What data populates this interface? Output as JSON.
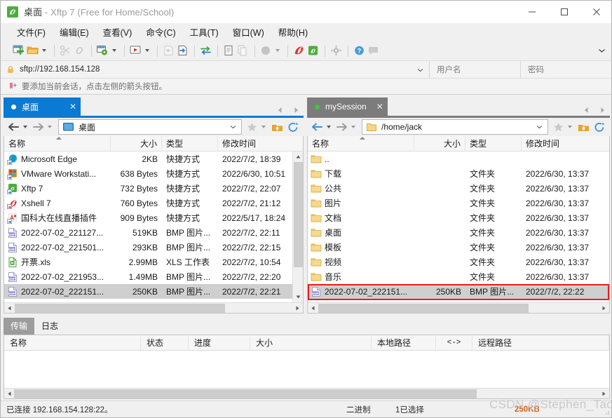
{
  "window": {
    "title_main": "桌面",
    "title_rest": " - Xftp 7 (Free for Home/School)",
    "app_icon": "xftp-logo-icon",
    "minimize": "—",
    "maximize": "▢",
    "close": "✕"
  },
  "menu": [
    {
      "label": "文件(F)",
      "name": "menu-file"
    },
    {
      "label": "编辑(E)",
      "name": "menu-edit"
    },
    {
      "label": "查看(V)",
      "name": "menu-view"
    },
    {
      "label": "命令(C)",
      "name": "menu-command"
    },
    {
      "label": "工具(T)",
      "name": "menu-tools"
    },
    {
      "label": "窗口(W)",
      "name": "menu-window"
    },
    {
      "label": "帮助(H)",
      "name": "menu-help"
    }
  ],
  "toolbar": {
    "items": [
      "new-session-icon",
      "open-folder-icon",
      "open-folder-dropdown",
      "cut-link-icon",
      "link-icon",
      "session-settings-icon",
      "session-settings-dropdown",
      "transfer-start-icon",
      "transfer-start-dropdown",
      "transfer-left-icon",
      "transfer-right-icon",
      "sync-transfer-icon",
      "paste-icon",
      "copy-icon",
      "status-circle-icon",
      "status-dropdown",
      "xshell-icon",
      "xftp-icon",
      "settings-gear-icon",
      "help-icon",
      "feedback-icon"
    ],
    "overflow": "overflow-chevron-icon"
  },
  "address": {
    "lock_icon": "lock-icon",
    "url": "sftp://192.168.154.128",
    "dropdown_icon": "chevron-down-icon",
    "username_placeholder": "用户名",
    "password_placeholder": "密码",
    "hint_icon": "bookmark-arrow-icon",
    "hint": "要添加当前会话，点击左侧的箭头按钮。"
  },
  "left_pane": {
    "tab": {
      "label": "桌面",
      "dot": "white-dot-icon",
      "close": "✕"
    },
    "nav": {
      "back": "back-arrow-icon",
      "back_dd": "chevron-down-icon",
      "forward": "forward-arrow-icon",
      "forward_dd": "chevron-down-icon",
      "path_icon": "desktop-icon",
      "path": "桌面",
      "path_chevron": "chevron-down-icon",
      "favorite": "star-icon",
      "favorite_dd": "chevron-down-icon",
      "home": "home-folder-icon",
      "refresh": "refresh-icon"
    },
    "columns": [
      "名称",
      "大小",
      "类型",
      "修改时间"
    ],
    "rows": [
      {
        "icon": "edge-shortcut-icon",
        "name": "Microsoft Edge",
        "size": "2KB",
        "type": "快捷方式",
        "time": "2022/7/2, 18:39",
        "selected": false
      },
      {
        "icon": "vmware-shortcut-icon",
        "name": "VMware Workstati...",
        "size": "638 Bytes",
        "type": "快捷方式",
        "time": "2022/6/30, 10:51",
        "selected": false
      },
      {
        "icon": "xftp-shortcut-icon",
        "name": "Xftp 7",
        "size": "732 Bytes",
        "type": "快捷方式",
        "time": "2022/7/2, 22:07",
        "selected": false
      },
      {
        "icon": "xshell-shortcut-icon",
        "name": "Xshell 7",
        "size": "760 Bytes",
        "type": "快捷方式",
        "time": "2022/7/2, 21:12",
        "selected": false
      },
      {
        "icon": "plugin-shortcut-icon",
        "name": "国科大在线直播插件",
        "size": "909 Bytes",
        "type": "快捷方式",
        "time": "2022/5/17, 18:24",
        "selected": false
      },
      {
        "icon": "bmp-file-icon",
        "name": "2022-07-02_221127...",
        "size": "519KB",
        "type": "BMP 图片...",
        "time": "2022/7/2, 22:11",
        "selected": false
      },
      {
        "icon": "bmp-file-icon",
        "name": "2022-07-02_221501...",
        "size": "293KB",
        "type": "BMP 图片...",
        "time": "2022/7/2, 22:15",
        "selected": false
      },
      {
        "icon": "xls-file-icon",
        "name": "开票.xls",
        "size": "2.99MB",
        "type": "XLS 工作表",
        "time": "2022/7/2, 10:54",
        "selected": false
      },
      {
        "icon": "bmp-file-icon",
        "name": "2022-07-02_221953...",
        "size": "1.49MB",
        "type": "BMP 图片...",
        "time": "2022/7/2, 22:20",
        "selected": false
      },
      {
        "icon": "bmp-file-icon",
        "name": "2022-07-02_222151...",
        "size": "250KB",
        "type": "BMP 图片...",
        "time": "2022/7/2, 22:21",
        "selected": true
      }
    ]
  },
  "right_pane": {
    "tab": {
      "label": "mySession",
      "dot": "green-dot-icon",
      "close": "✕"
    },
    "nav": {
      "back": "back-arrow-icon",
      "back_dd": "chevron-down-icon",
      "forward": "forward-arrow-icon",
      "forward_dd": "chevron-down-icon",
      "path_icon": "folder-icon",
      "path": "/home/jack",
      "path_chevron": "chevron-down-icon",
      "favorite": "star-icon",
      "favorite_dd": "chevron-down-icon",
      "home": "home-folder-icon",
      "refresh": "refresh-icon"
    },
    "columns": [
      "名称",
      "大小",
      "类型",
      "修改时间"
    ],
    "rows": [
      {
        "icon": "folder-icon",
        "name": "..",
        "size": "",
        "type": "",
        "time": "",
        "highlight": false
      },
      {
        "icon": "folder-icon",
        "name": "下载",
        "size": "",
        "type": "文件夹",
        "time": "2022/6/30, 13:37",
        "highlight": false
      },
      {
        "icon": "folder-icon",
        "name": "公共",
        "size": "",
        "type": "文件夹",
        "time": "2022/6/30, 13:37",
        "highlight": false
      },
      {
        "icon": "folder-icon",
        "name": "图片",
        "size": "",
        "type": "文件夹",
        "time": "2022/6/30, 13:37",
        "highlight": false
      },
      {
        "icon": "folder-icon",
        "name": "文档",
        "size": "",
        "type": "文件夹",
        "time": "2022/6/30, 13:37",
        "highlight": false
      },
      {
        "icon": "folder-icon",
        "name": "桌面",
        "size": "",
        "type": "文件夹",
        "time": "2022/6/30, 13:37",
        "highlight": false
      },
      {
        "icon": "folder-icon",
        "name": "模板",
        "size": "",
        "type": "文件夹",
        "time": "2022/6/30, 13:37",
        "highlight": false
      },
      {
        "icon": "folder-icon",
        "name": "视频",
        "size": "",
        "type": "文件夹",
        "time": "2022/6/30, 13:37",
        "highlight": false
      },
      {
        "icon": "folder-icon",
        "name": "音乐",
        "size": "",
        "type": "文件夹",
        "time": "2022/6/30, 13:37",
        "highlight": false
      },
      {
        "icon": "bmp-file-icon",
        "name": "2022-07-02_222151...",
        "size": "250KB",
        "type": "BMP 图片...",
        "time": "2022/7/2, 22:22",
        "highlight": true
      }
    ],
    "highlight_color": "#ee1b1b"
  },
  "bottom": {
    "tabs": [
      {
        "label": "传输",
        "name": "tab-transfer",
        "active": true
      },
      {
        "label": "日志",
        "name": "tab-log",
        "active": false
      }
    ],
    "columns": [
      "名称",
      "状态",
      "进度",
      "大小",
      "本地路径",
      "<->",
      "远程路径"
    ],
    "rows": []
  },
  "status": {
    "connection": "已连接 192.168.154.128:22。",
    "mode": "二进制",
    "selection": "1已选择",
    "size": "250KB"
  },
  "watermark": "CSDN @Stephen_Tao"
}
